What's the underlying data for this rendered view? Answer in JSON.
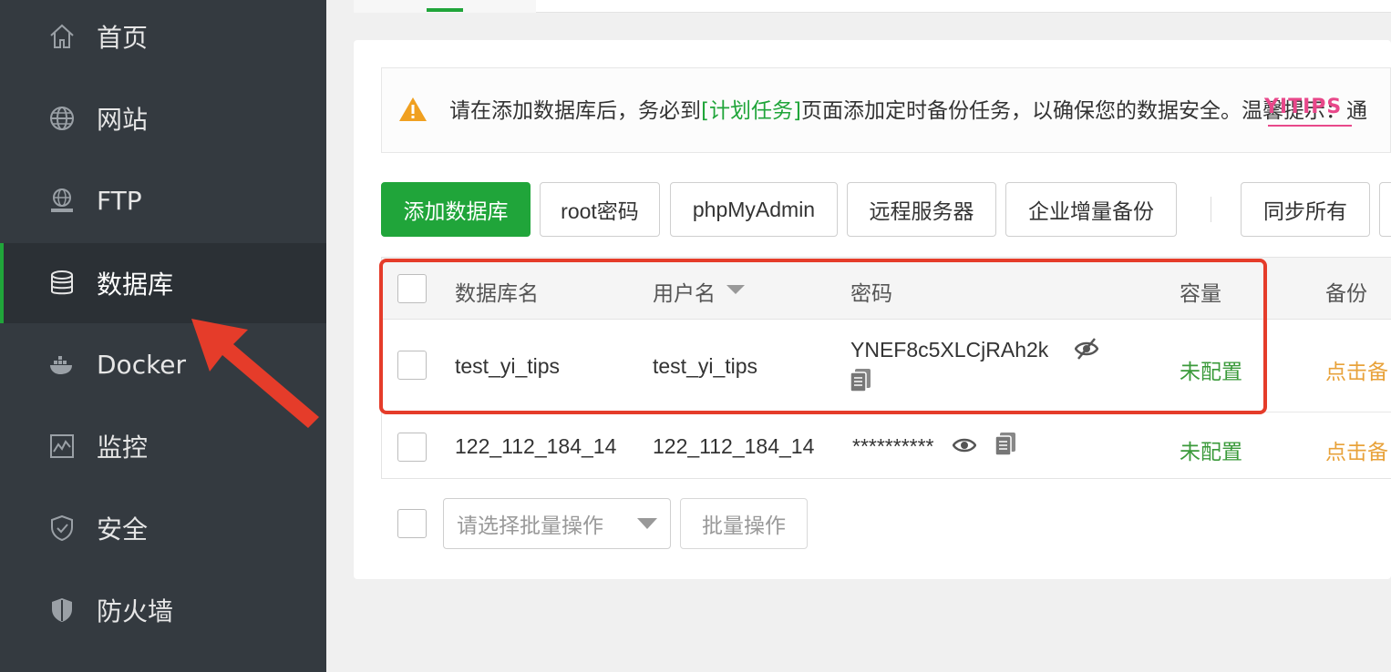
{
  "sidebar": {
    "items": [
      {
        "label": "首页",
        "icon": "home-icon"
      },
      {
        "label": "网站",
        "icon": "globe-icon"
      },
      {
        "label": "FTP",
        "icon": "ftp-icon"
      },
      {
        "label": "数据库",
        "icon": "database-icon",
        "active": true
      },
      {
        "label": "Docker",
        "icon": "docker-icon"
      },
      {
        "label": "监控",
        "icon": "monitor-icon"
      },
      {
        "label": "安全",
        "icon": "shield-icon"
      },
      {
        "label": "防火墙",
        "icon": "firewall-icon"
      }
    ]
  },
  "notice": {
    "text_before": "请在添加数据库后，务必到",
    "link": "[计划任务]",
    "text_after": "页面添加定时备份任务，以确保您的数据安全。温馨提示：通",
    "watermark": "YITIPS"
  },
  "toolbar": {
    "add_database": "添加数据库",
    "root_password": "root密码",
    "phpmyadmin": "phpMyAdmin",
    "remote_server": "远程服务器",
    "incremental_backup": "企业增量备份",
    "sync_all": "同步所有"
  },
  "table": {
    "headers": {
      "name": "数据库名",
      "user": "用户名",
      "password": "密码",
      "capacity": "容量",
      "backup": "备份"
    },
    "rows": [
      {
        "name": "test_yi_tips",
        "user": "test_yi_tips",
        "password": "YNEF8c5XLCjRAh2k",
        "capacity": "未配置",
        "backup": "点击备"
      },
      {
        "name": "122_112_184_14",
        "user": "122_112_184_14",
        "password": "**********",
        "capacity": "未配置",
        "backup": "点击备"
      }
    ]
  },
  "bulk": {
    "select_placeholder": "请选择批量操作",
    "button": "批量操作"
  },
  "colors": {
    "accent": "#20a53a",
    "sidebar_bg": "#343a40",
    "highlight": "#e53c2a",
    "orange": "#e8a23a"
  }
}
